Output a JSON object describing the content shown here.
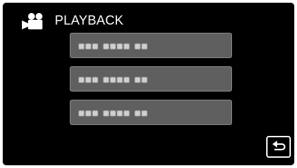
{
  "header": {
    "title": "PLAYBACK",
    "icon": "video-camera-icon"
  },
  "options": [
    {
      "label_state": "pixelated-unreadable"
    },
    {
      "label_state": "pixelated-unreadable"
    },
    {
      "label_state": "pixelated-unreadable"
    }
  ],
  "back_button": {
    "icon": "return-arrow-icon"
  },
  "colors": {
    "screen_background": "#000000",
    "button_fill": "#5f5f5f",
    "button_border": "#8e8e8e",
    "text": "#ffffff"
  }
}
